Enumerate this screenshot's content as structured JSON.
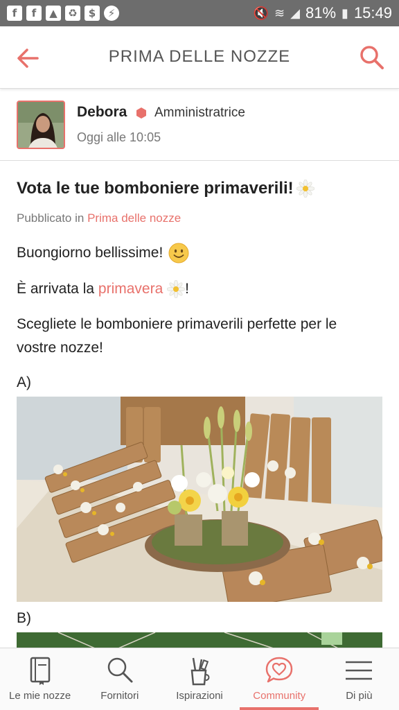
{
  "status_bar": {
    "battery": "81%",
    "time": "15:49",
    "left_icons": [
      "facebook-icon",
      "facebook-icon",
      "image-icon",
      "recycle-icon",
      "dollar-icon",
      "messenger-icon"
    ]
  },
  "header": {
    "title": "PRIMA DELLE NOZZE"
  },
  "author": {
    "name": "Debora",
    "role": "Amministratrice",
    "time": "Oggi alle 10:05"
  },
  "post": {
    "title": "Vota le tue bomboniere primaverili!",
    "published_prefix": "Pubblicato in",
    "published_category": "Prima delle nozze",
    "line1": "Buongiorno bellissime!",
    "line2_prefix": "È arrivata la",
    "line2_link": "primavera",
    "line2_suffix": "!",
    "line3": "Scegliete le bomboniere primaverili perfette per le vostre nozze!",
    "option_a": "A)",
    "option_b": "B)"
  },
  "bottom_nav": {
    "items": [
      {
        "label": "Le mie nozze",
        "icon": "book-icon"
      },
      {
        "label": "Fornitori",
        "icon": "search-icon"
      },
      {
        "label": "Ispirazioni",
        "icon": "brushes-icon"
      },
      {
        "label": "Community",
        "icon": "heart-chat-icon"
      },
      {
        "label": "Di più",
        "icon": "menu-icon"
      }
    ],
    "active": "Community"
  },
  "colors": {
    "accent": "#e8716b",
    "status_bar": "#6d6d6d"
  }
}
